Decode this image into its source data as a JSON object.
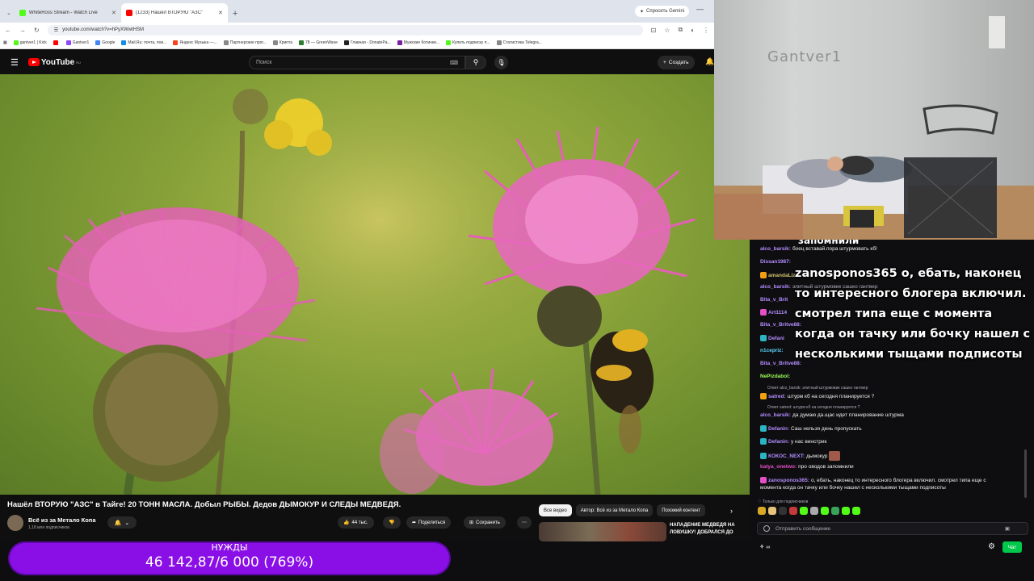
{
  "browser": {
    "tabs": [
      {
        "title": "WhiteRoss Stream - Watch Live",
        "color": "#53fc18"
      },
      {
        "title": "(1233) Нашёл ВТОРУЮ \"АЗС\"",
        "color": "#ff0000"
      }
    ],
    "gemini_label": "Спросить Gemini",
    "url": "youtube.com/watch?v=hPyXWwtHSM",
    "bookmarks": [
      {
        "label": "gantver1 | Kick",
        "color": "#53fc18"
      },
      {
        "label": "",
        "color": "#ff0000"
      },
      {
        "label": "Gantver1",
        "color": "#9146ff"
      },
      {
        "label": "Google",
        "color": "#4285f4"
      },
      {
        "label": "Mail.Ru: почта, пои...",
        "color": "#168de2"
      },
      {
        "label": "Яндекс Музыка —...",
        "color": "#fc3f1d"
      },
      {
        "label": "Партнерские прог...",
        "color": "#888888"
      },
      {
        "label": "Крипта",
        "color": "#888888"
      },
      {
        "label": "78 — GreenWave",
        "color": "#2e7d32"
      },
      {
        "label": "Главная - DonatePa...",
        "color": "#222222"
      },
      {
        "label": "Мужские ботинки...",
        "color": "#7b1fa2"
      },
      {
        "label": "Купить подписку п...",
        "color": "#53fc18"
      },
      {
        "label": "Статистика Telegra...",
        "color": "#888888"
      }
    ]
  },
  "youtube": {
    "logo": "YouTube",
    "region": "RU",
    "search_placeholder": "Поиск",
    "create_label": "Создать",
    "video_title": "Нашёл ВТОРУЮ \"АЗС\" в Тайге! 20 ТОНН МАСЛА. Добыл РЫБЫ. Дедов ДЫМОКУР И СЛЕДЫ МЕДВЕДЯ.",
    "channel_name": "Всё из за Метало Копа",
    "channel_subs": "1,18 млн подписчиков",
    "likes": "44 тыс.",
    "share_label": "Поделиться",
    "save_label": "Сохранить",
    "chips": [
      "Все видео",
      "Автор: Всё из за Метало Копа",
      "Похожий контент"
    ],
    "reco_title": "НАПАДЕНИЕ МЕДВЕДЯ НА ЛОВУШКУ! ДОБРАЛСЯ ДО"
  },
  "donation": {
    "label": "НУЖДЫ",
    "amount": "46 142,87/6 000 (769%)",
    "progress_percent": 769
  },
  "webcam": {
    "wall_text": "Gantver1"
  },
  "chat": {
    "ghost_text": "запомнили",
    "overlay_user": "zanosponos365",
    "overlay_text": "о, ебать, наконец то интересного блогера включил. смотрел типа еще с момента когда он тачку или бочку нашел с несколькими тыщами подписоты",
    "messages": [
      {
        "user": "alco_barsik:",
        "text": "боец вставай.пора штурмовать кб!",
        "color": "#b38cff",
        "badge": ""
      },
      {
        "user": "Dissan1987:",
        "text": "",
        "color": "#b38cff",
        "badge": ""
      },
      {
        "user": "amandaLiz",
        "text": "",
        "color": "#d1c36b",
        "badge": "#f0a010"
      },
      {
        "user": "alco_barsik:",
        "text": "элитный штурмовик сашко гантвер",
        "color": "#b38cff",
        "badge": ""
      },
      {
        "user": "Bita_v_Brit",
        "text": "",
        "color": "#b38cff",
        "badge": ""
      },
      {
        "user": "Art1114",
        "text": "",
        "color": "#b38cff",
        "badge": "#e64fc8"
      },
      {
        "user": "Bita_v_Britve88:",
        "text": "",
        "color": "#b38cff",
        "badge": ""
      },
      {
        "user": "Defani",
        "text": "",
        "color": "#b38cff",
        "badge": "#2bb5c4"
      },
      {
        "user": "n1cepriz:",
        "text": "",
        "color": "#5dd6ff",
        "badge": ""
      },
      {
        "user": "Bita_v_Britve88:",
        "text": "",
        "color": "#b38cff",
        "badge": ""
      },
      {
        "user": "NePizdabol:",
        "text": "",
        "color": "#9cff57",
        "badge": ""
      }
    ],
    "reply1": "Ответ alco_barsik: элитный штурмовик сашко гантвер",
    "messages2": [
      {
        "user": "satred:",
        "text": "штурм кб на сегодня планируется ?",
        "color": "#b38cff",
        "badge": "#f0a010"
      }
    ],
    "reply2": "Ответ satred: штурм кб на сегодня планируется ?",
    "messages3": [
      {
        "user": "alco_barsik:",
        "text": "да думаю да.щас идет планирование штурма",
        "color": "#b38cff",
        "badge": ""
      },
      {
        "user": "Defanin:",
        "text": "Саш нельзя день пропускать",
        "color": "#b38cff",
        "badge": "#2bb5c4"
      },
      {
        "user": "Defanin:",
        "text": "у нас винстрик",
        "color": "#b38cff",
        "badge": "#2bb5c4"
      },
      {
        "user": "КОКОС_NEXT:",
        "text": "дымокур",
        "color": "#b38cff",
        "badge": "#2bb5c4"
      },
      {
        "user": "katya_onetwo:",
        "text": "про оводов запомнили",
        "color": "#e64fc8",
        "badge": ""
      },
      {
        "user": "zanosponos365:",
        "text": "о, ебать, наконец то интересного блогера включил. смотрел типа еще с",
        "color": "#b38cff",
        "badge": "#e64fc8"
      }
    ],
    "last_cont": "момента когда он тачку или бочку нашел с несколькими тыщами подписоты",
    "subs_only": "Только для подписчиков",
    "send_placeholder": "Отправить сообщение",
    "chat_button": "Чат"
  }
}
